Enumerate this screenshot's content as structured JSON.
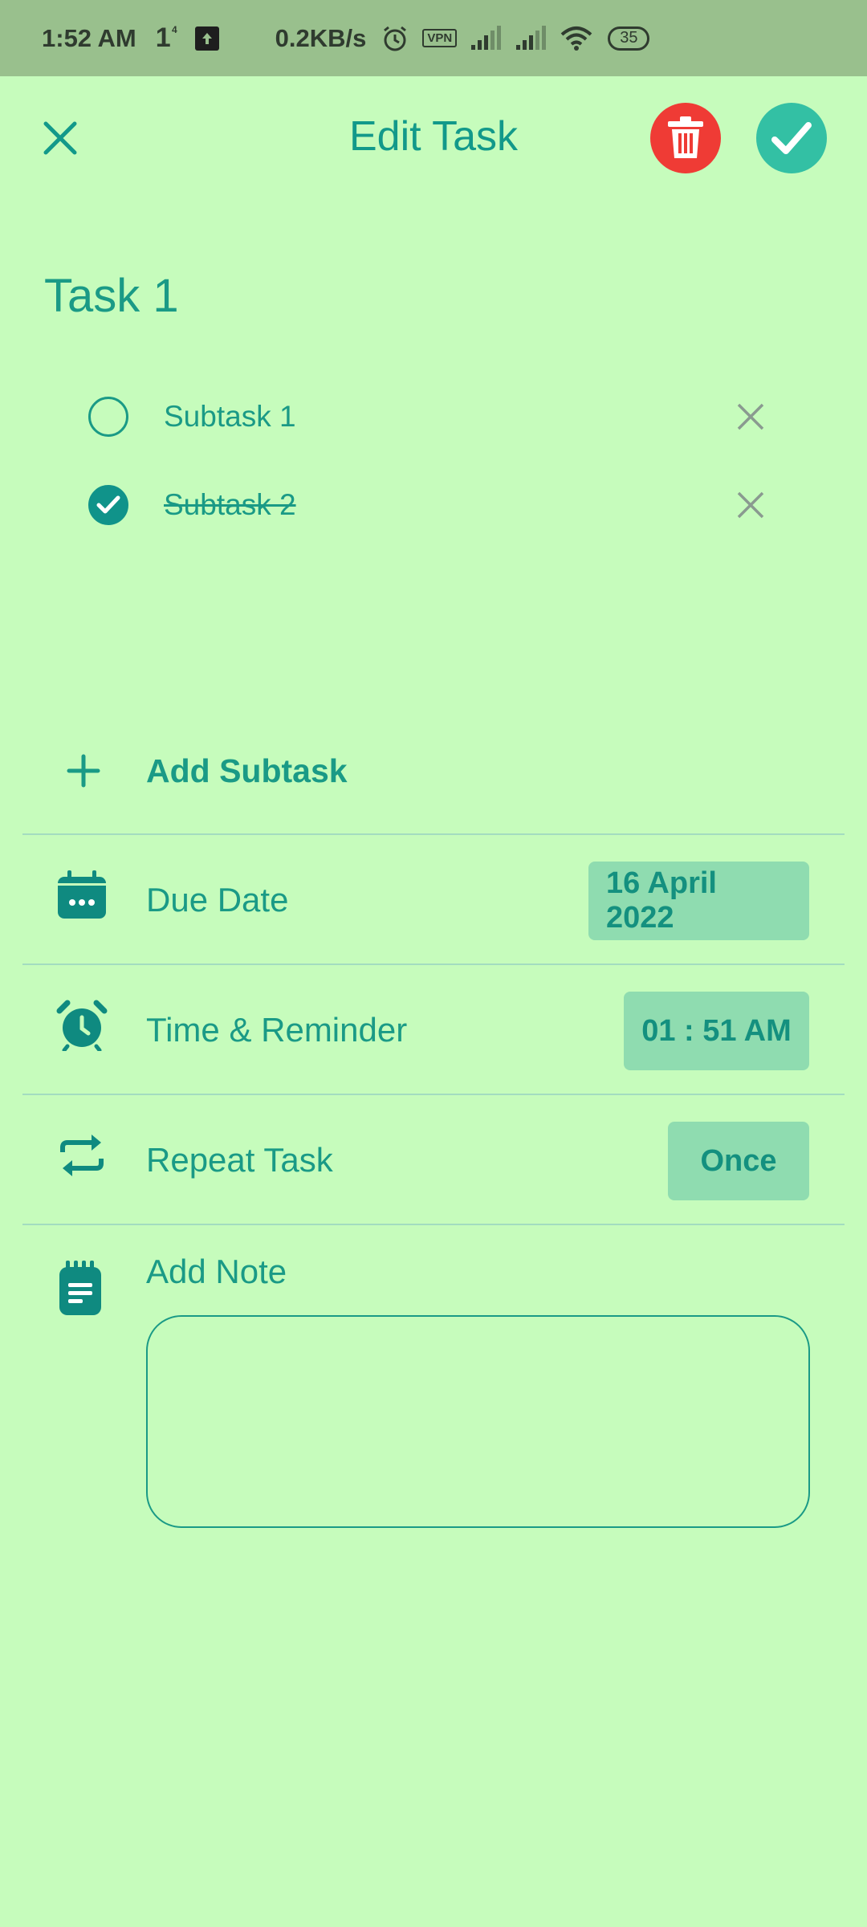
{
  "status_bar": {
    "time": "1:52 AM",
    "sim": "1",
    "sim_sup": "4",
    "speed": "0.2KB/s",
    "vpn": "VPN",
    "battery": "35"
  },
  "header": {
    "title": "Edit Task"
  },
  "task": {
    "title": "Task 1",
    "subtasks": [
      {
        "label": "Subtask 1",
        "done": false
      },
      {
        "label": "Subtask 2",
        "done": true
      }
    ],
    "add_subtask_label": "Add Subtask"
  },
  "rows": {
    "due_date": {
      "label": "Due Date",
      "value": "16 April 2022"
    },
    "time_reminder": {
      "label": "Time & Reminder",
      "value": "01 : 51 AM"
    },
    "repeat": {
      "label": "Repeat Task",
      "value": "Once"
    }
  },
  "note": {
    "label": "Add Note",
    "value": ""
  },
  "colors": {
    "background": "#c6fcbc",
    "accent": "#1a9a86",
    "delete": "#ef3b35",
    "confirm": "#33c0a4",
    "chip": "#8fdcb0"
  }
}
